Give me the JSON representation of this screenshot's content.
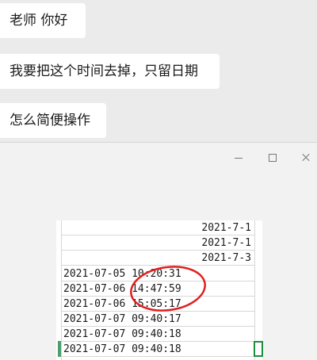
{
  "chat": {
    "messages": [
      {
        "text": "老师  你好"
      },
      {
        "text": "我要把这个时间去掉，只留日期"
      },
      {
        "text": "怎么简便操作"
      }
    ]
  },
  "viewer": {
    "controls": {
      "minimize_icon": "minimize-icon",
      "maximize_icon": "maximize-icon",
      "close_icon": "close-icon"
    },
    "sheet": {
      "top_rows_right": [
        "2021-7-1",
        "2021-7-1",
        "2021-7-3"
      ],
      "datetime_rows": [
        "2021-07-05 10:20:31",
        "2021-07-06 14:47:59",
        "2021-07-06 15:05:17",
        "2021-07-07 09:40:17",
        "2021-07-07 09:40:18",
        "2021-07-07 09:40:18"
      ]
    },
    "annotation_color": "#e02020",
    "selection_color": "#1e8e3e"
  }
}
